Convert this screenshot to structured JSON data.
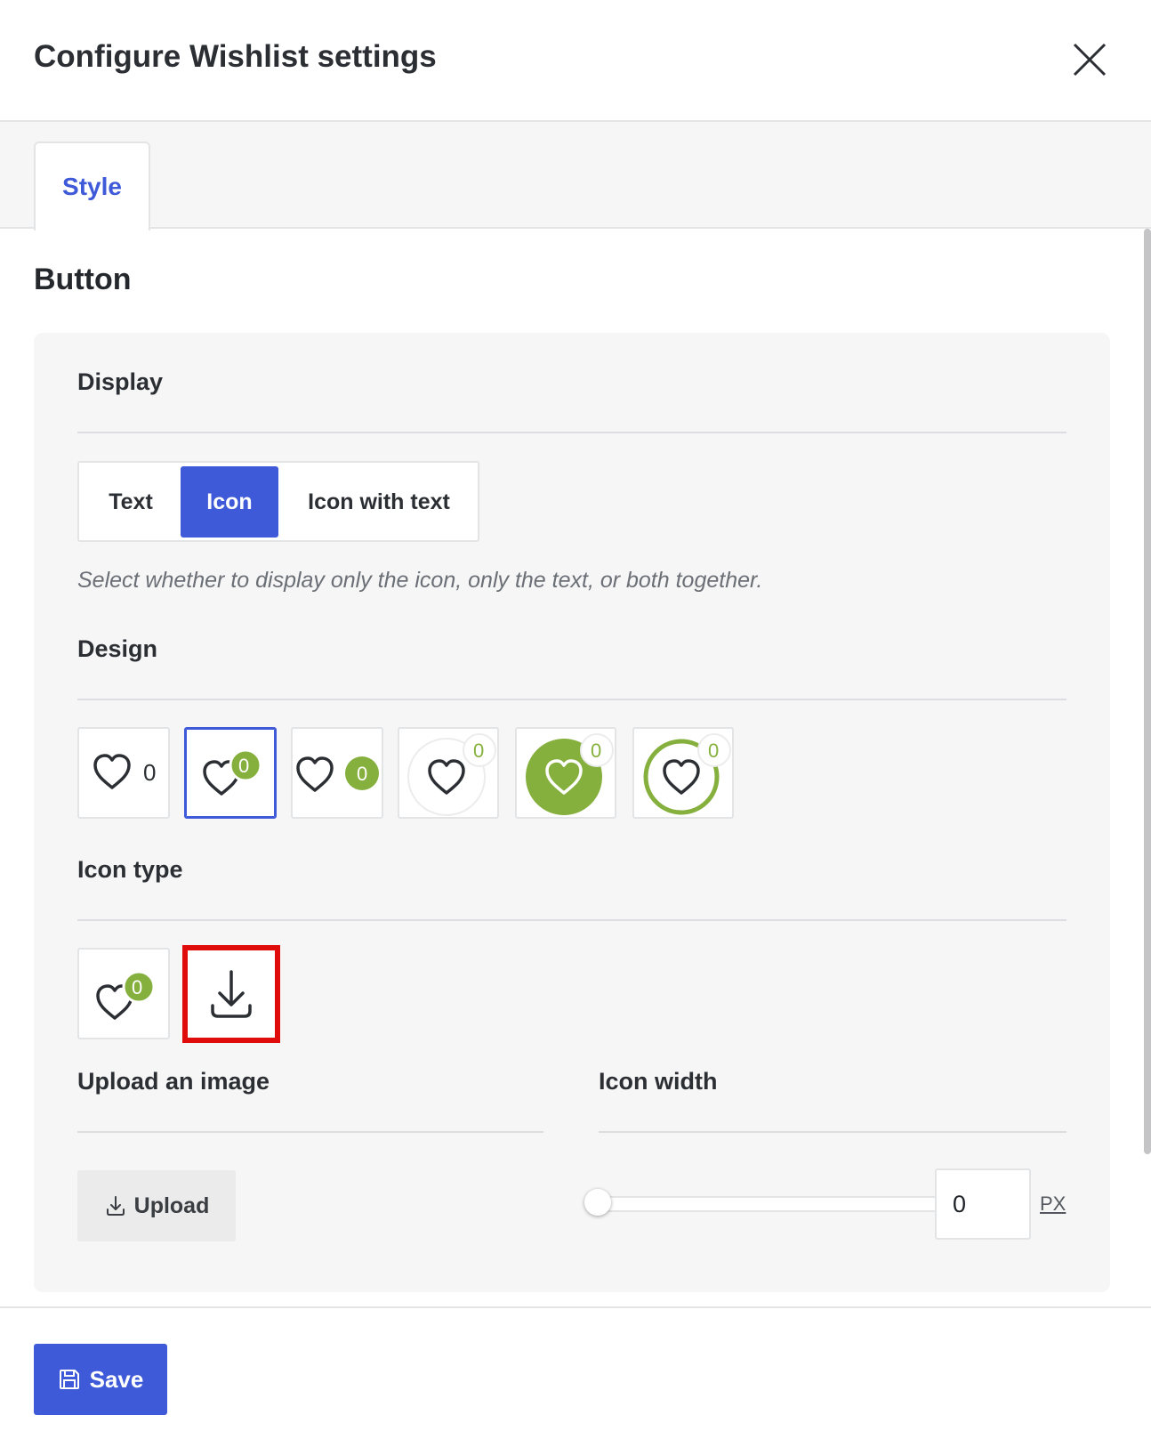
{
  "header": {
    "title": "Configure Wishlist settings",
    "close_icon": "close-icon"
  },
  "tabs": [
    {
      "label": "Style",
      "active": true
    }
  ],
  "section": {
    "title": "Button"
  },
  "display": {
    "label": "Display",
    "options": [
      "Text",
      "Icon",
      "Icon with text"
    ],
    "selected": "Icon",
    "help": "Select whether to display only the icon, only the text, or both together."
  },
  "design": {
    "label": "Design",
    "selected_index": 1,
    "tiles": [
      {
        "count": "0"
      },
      {
        "count": "0"
      },
      {
        "count": "0"
      },
      {
        "count": "0"
      },
      {
        "count": "0"
      },
      {
        "count": "0"
      }
    ]
  },
  "icon_type": {
    "label": "Icon type",
    "options": [
      {
        "icon": "heart-icon",
        "count": "0"
      },
      {
        "icon": "download-icon"
      }
    ]
  },
  "upload": {
    "label": "Upload an image",
    "button_label": "Upload",
    "icon": "upload-icon"
  },
  "icon_width": {
    "label": "Icon width",
    "value": "0",
    "unit": "PX",
    "slider_value": 0
  },
  "footer": {
    "save_label": "Save",
    "save_icon": "save-icon"
  },
  "colors": {
    "accent": "#3f5ad8",
    "green": "#86b03e",
    "highlight": "#e00c0c"
  }
}
